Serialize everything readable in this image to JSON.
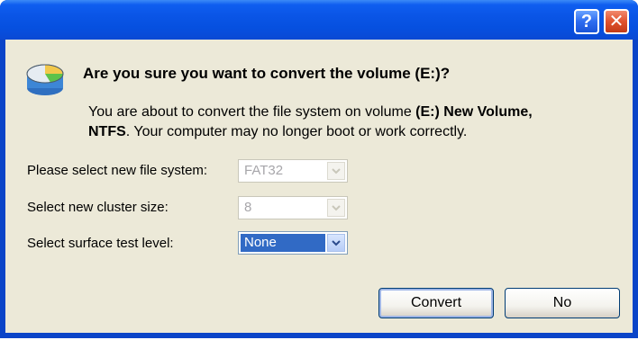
{
  "titlebar": {
    "help_label": "?",
    "close_label": "✕"
  },
  "dialog": {
    "heading": "Are you sure you want to convert the volume (E:)?",
    "desc_part1": "You are about to convert the file system on volume ",
    "desc_bold1": "(E:) New Volume,",
    "desc_bold2": "NTFS",
    "desc_part2": ". Your computer may no longer boot or work correctly."
  },
  "form": {
    "file_system_label": "Please select new file system:",
    "file_system_value": "FAT32",
    "cluster_label": "Select new cluster size:",
    "cluster_value": "8",
    "surface_label": "Select surface test level:",
    "surface_value": "None"
  },
  "buttons": {
    "convert": "Convert",
    "no": "No"
  }
}
